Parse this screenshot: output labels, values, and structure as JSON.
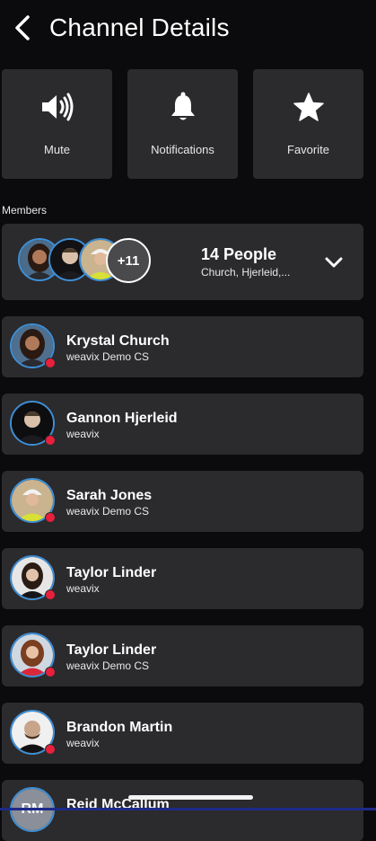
{
  "header": {
    "title": "Channel Details",
    "back_icon": "chevron-left-icon"
  },
  "actions": [
    {
      "label": "Mute",
      "icon": "speaker-volume-icon"
    },
    {
      "label": "Notifications",
      "icon": "bell-icon"
    },
    {
      "label": "Favorite",
      "icon": "star-icon"
    }
  ],
  "members_label": "Members",
  "summary": {
    "more_count": "+11",
    "title": "14 People",
    "subtitle": "Church, Hjerleid,...",
    "chevron_icon": "chevron-down-icon"
  },
  "members": [
    {
      "name": "Krystal Church",
      "org": "weavix Demo CS"
    },
    {
      "name": "Gannon Hjerleid",
      "org": "weavix"
    },
    {
      "name": "Sarah Jones",
      "org": "weavix Demo CS"
    },
    {
      "name": "Taylor Linder",
      "org": "weavix"
    },
    {
      "name": "Taylor Linder",
      "org": "weavix Demo CS"
    },
    {
      "name": "Brandon Martin",
      "org": "weavix"
    },
    {
      "name": "Reid McCallum",
      "org": "",
      "initials": "RM"
    }
  ],
  "colors": {
    "background": "#0b0a0c",
    "card": "#2b2a2d",
    "avatar_ring": "#3d8fd6",
    "status_dot": "#e8203c"
  }
}
